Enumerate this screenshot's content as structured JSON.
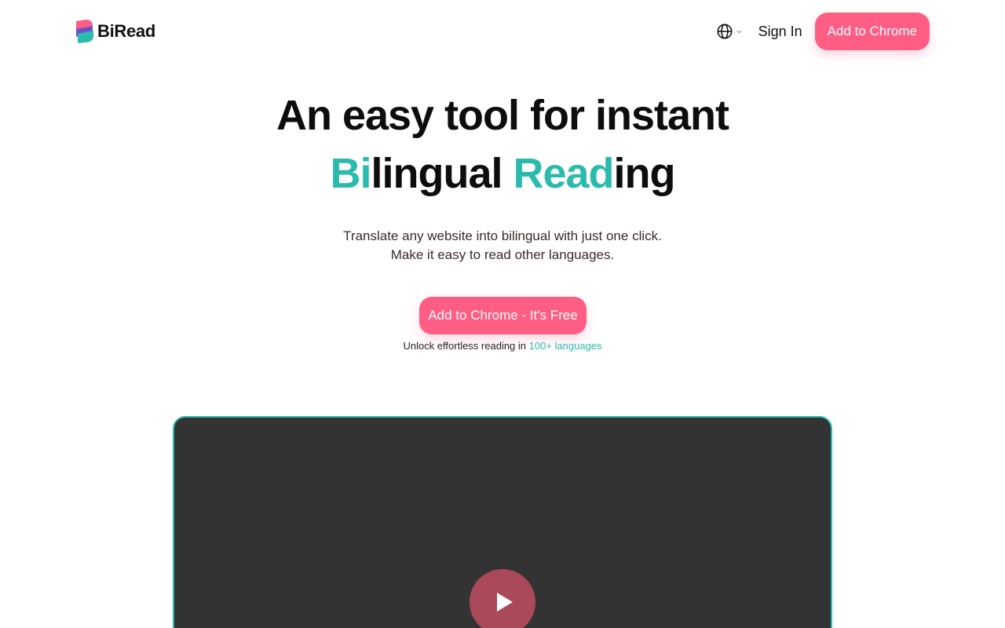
{
  "brand": {
    "name": "BiRead",
    "logo_icon": "biread-logo-icon"
  },
  "nav": {
    "language_icon": "globe-icon",
    "sign_in": "Sign In",
    "cta": "Add to Chrome"
  },
  "hero": {
    "title_line1": "An easy tool for instant",
    "title_line2": {
      "part1_accent": "Bi",
      "part2": "lingual ",
      "part3_accent": "Read",
      "part4": "ing"
    },
    "subtitle_line1": "Translate any website into bilingual with just one click.",
    "subtitle_line2": "Make it easy to read other languages.",
    "cta": "Add to Chrome - It's Free",
    "unlock_prefix": "Unlock effortless reading in ",
    "unlock_link": "100+ languages"
  },
  "video": {
    "play_icon": "play-icon"
  },
  "colors": {
    "accent_teal": "#2bbbad",
    "brand_pink": "#ff5e84",
    "video_bg": "#333333",
    "play_button": "#a9495a"
  }
}
